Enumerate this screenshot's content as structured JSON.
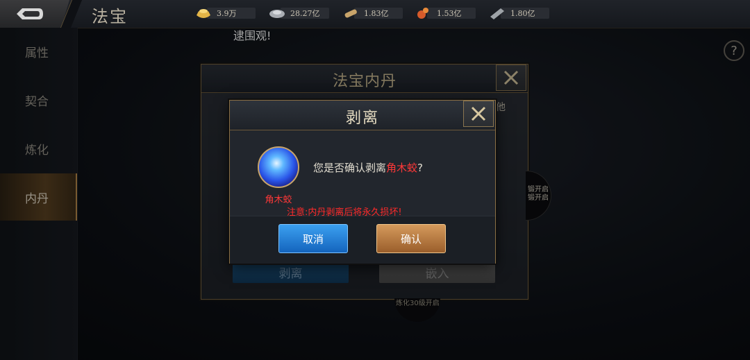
{
  "header": {
    "title": "法宝",
    "resources": [
      {
        "icon": "gold-ingot-icon",
        "value": "3.9万"
      },
      {
        "icon": "silver-ingot-icon",
        "value": "28.27亿"
      },
      {
        "icon": "scroll-icon",
        "value": "1.83亿"
      },
      {
        "icon": "gourd-icon",
        "value": "1.53亿"
      },
      {
        "icon": "whetstone-icon",
        "value": "1.80亿"
      }
    ]
  },
  "marquee": "逮围观!",
  "sidebar": {
    "items": [
      {
        "label": "属性",
        "active": false
      },
      {
        "label": "契合",
        "active": false
      },
      {
        "label": "炼化",
        "active": false
      },
      {
        "label": "内丹",
        "active": true
      }
    ]
  },
  "help": "?",
  "background_dialog": {
    "title": "法宝内丹",
    "other_text": "他",
    "side_note_1": "锻开启",
    "side_note_2": "锻开启",
    "strip_label": "剥离",
    "embed_label": "嵌入",
    "bottom_note": "炼化30级开启"
  },
  "confirm_dialog": {
    "title": "剥离",
    "item_name": "角木蛟",
    "question_prefix": "您是否确认剥离",
    "question_item": "角木蛟",
    "question_suffix": "?",
    "warning": "注意:内丹剥离后将永久损坏!",
    "cancel_label": "取消",
    "confirm_label": "确认"
  },
  "colors": {
    "highlight_red": "#ff3838",
    "cancel_blue": "#1e78d2",
    "confirm_gold": "#c28447"
  }
}
